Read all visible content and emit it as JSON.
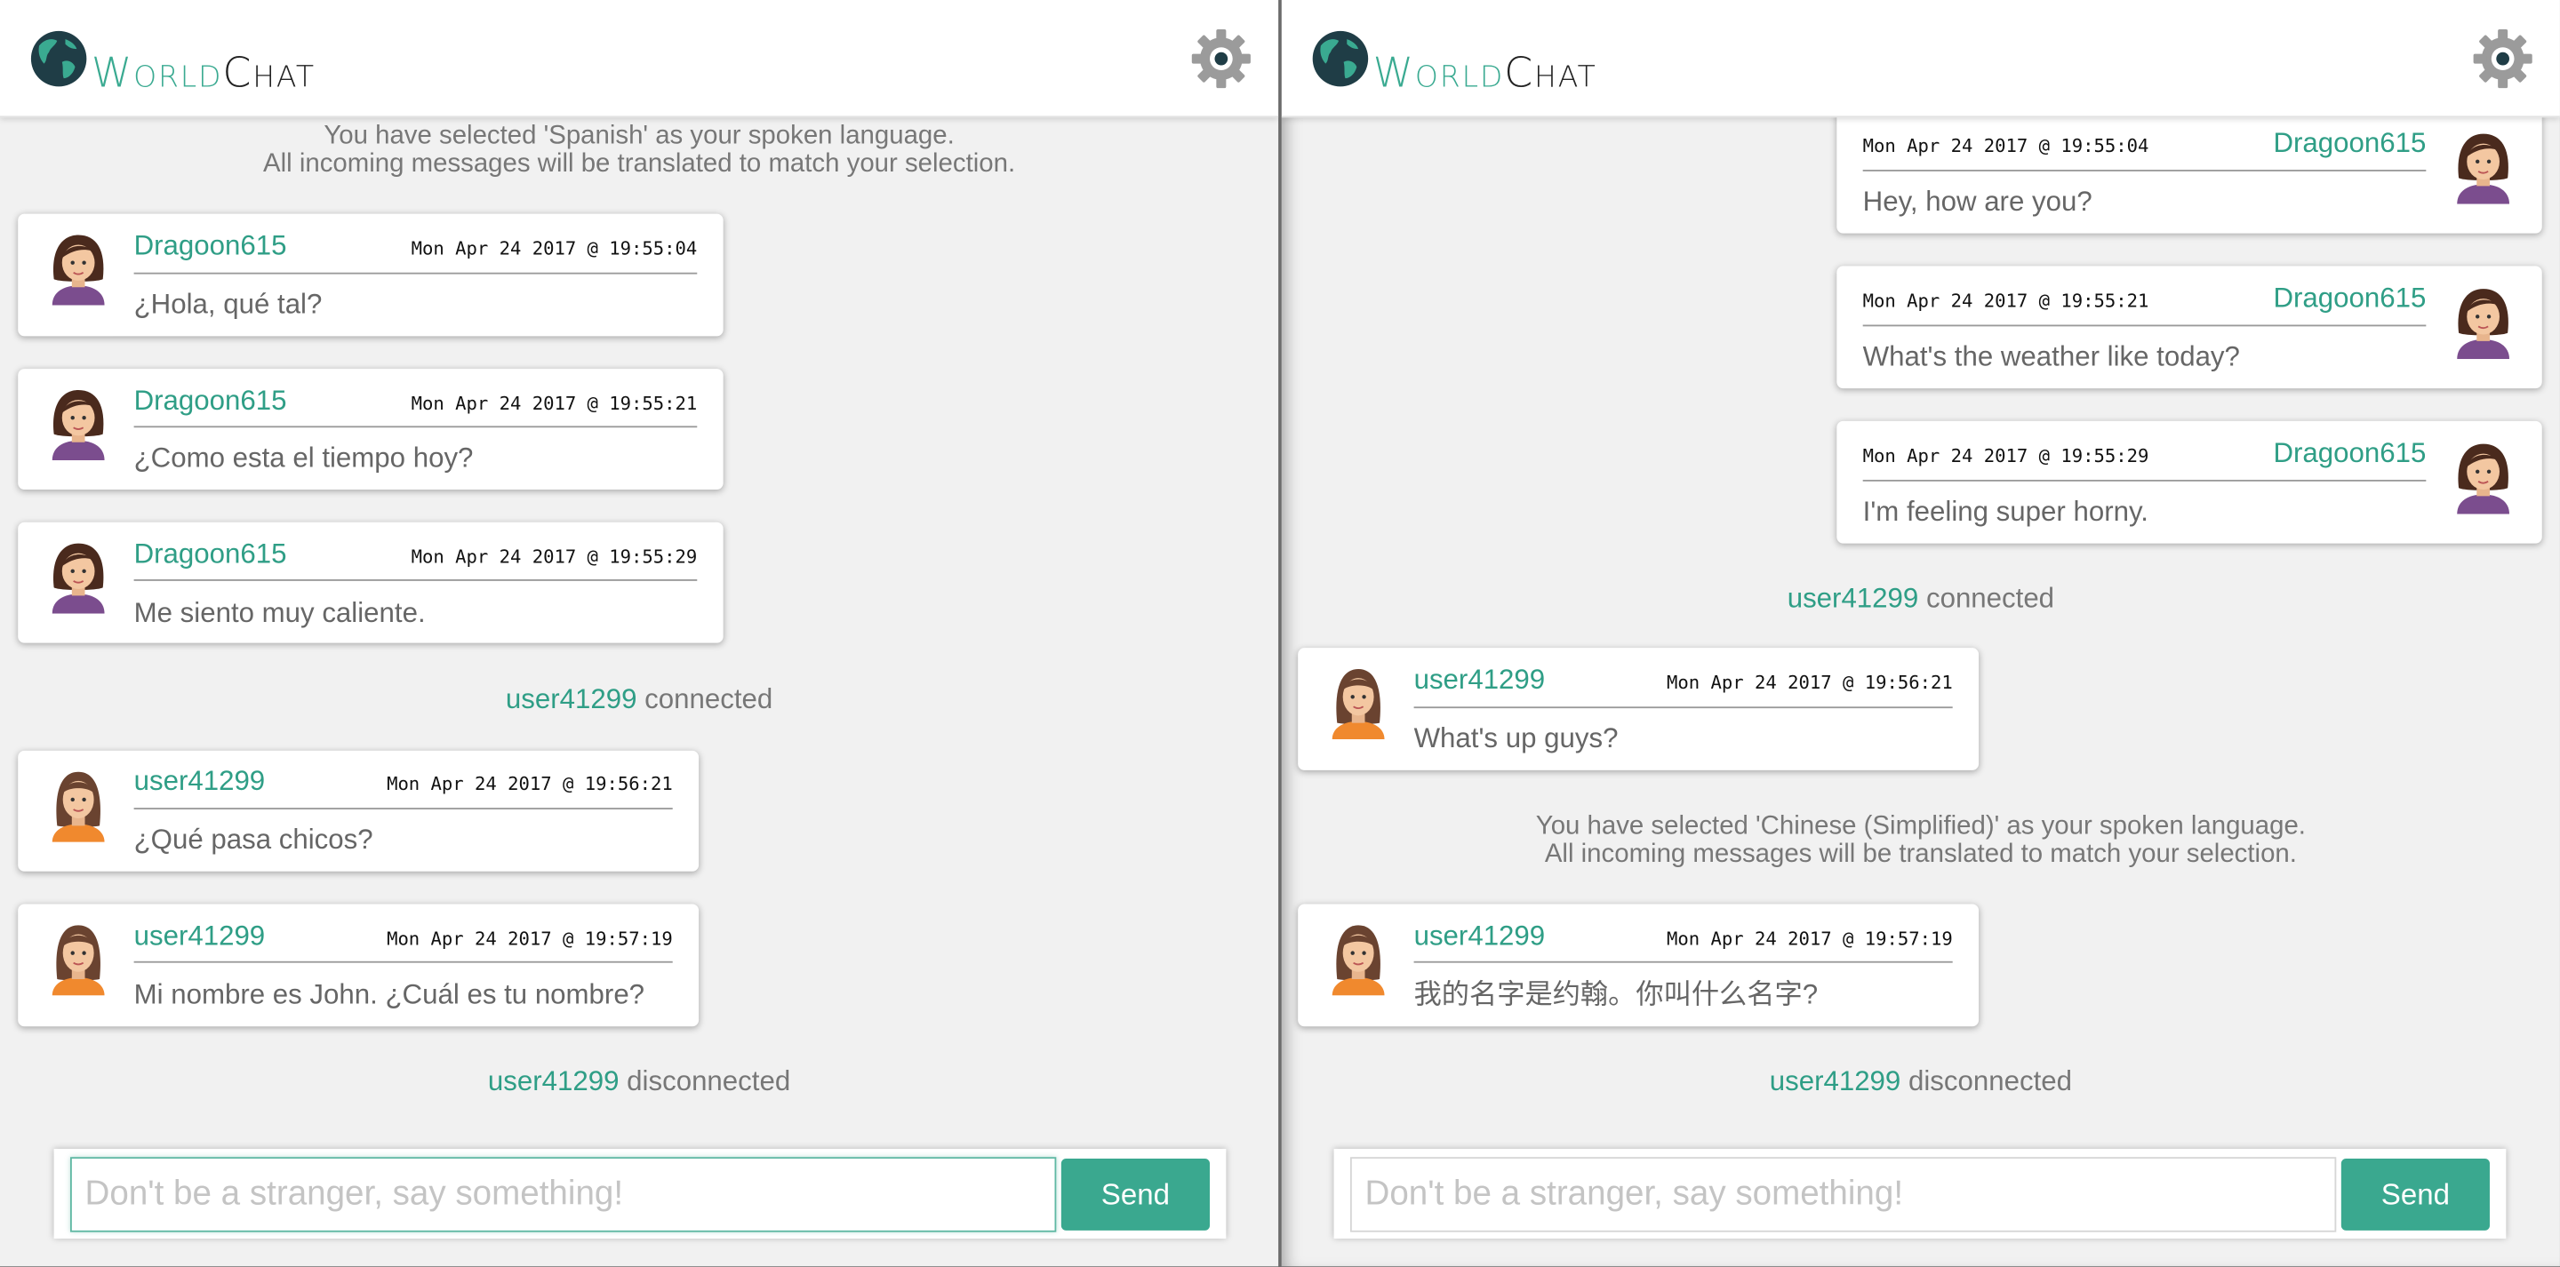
{
  "app": {
    "logo_part1": "World",
    "logo_part2": "Chat"
  },
  "colors": {
    "accent": "#3aaa91",
    "background": "#f1f1f1"
  },
  "left": {
    "language_notice": {
      "line1": "You have selected 'Spanish' as your spoken language.",
      "line2": "All incoming messages will be translated to match your selection."
    },
    "messages": [
      {
        "user": "Dragoon615",
        "time": "Mon Apr 24 2017 @ 19:55:04",
        "text": "¿Hola, qué tal?"
      },
      {
        "user": "Dragoon615",
        "time": "Mon Apr 24 2017 @ 19:55:21",
        "text": "¿Como esta el tiempo hoy?"
      },
      {
        "user": "Dragoon615",
        "time": "Mon Apr 24 2017 @ 19:55:29",
        "text": "Me siento muy caliente."
      },
      {
        "user": "user41299",
        "time": "Mon Apr 24 2017 @ 19:56:21",
        "text": "¿Qué pasa chicos?"
      },
      {
        "user": "user41299",
        "time": "Mon Apr 24 2017 @ 19:57:19",
        "text": "Mi nombre es John. ¿Cuál es tu nombre?"
      }
    ],
    "status_connected": {
      "user": "user41299",
      "text": "connected"
    },
    "status_disconnected": {
      "user": "user41299",
      "text": "disconnected"
    },
    "composer": {
      "placeholder": "Don't be a stranger, say something!",
      "send_label": "Send"
    }
  },
  "right": {
    "messages_own": [
      {
        "user": "Dragoon615",
        "time": "Mon Apr 24 2017 @ 19:55:04",
        "text": "Hey, how are you?"
      },
      {
        "user": "Dragoon615",
        "time": "Mon Apr 24 2017 @ 19:55:21",
        "text": "What's the weather like today?"
      },
      {
        "user": "Dragoon615",
        "time": "Mon Apr 24 2017 @ 19:55:29",
        "text": "I'm feeling super horny."
      }
    ],
    "status_connected": {
      "user": "user41299",
      "text": "connected"
    },
    "messages": [
      {
        "user": "user41299",
        "time": "Mon Apr 24 2017 @ 19:56:21",
        "text": "What's up guys?"
      },
      {
        "user": "user41299",
        "time": "Mon Apr 24 2017 @ 19:57:19",
        "text": "我的名字是约翰。你叫什么名字?"
      }
    ],
    "language_notice": {
      "line1": "You have selected 'Chinese (Simplified)' as your spoken language.",
      "line2": "All incoming messages will be translated to match your selection."
    },
    "status_disconnected": {
      "user": "user41299",
      "text": "disconnected"
    },
    "composer": {
      "placeholder": "Don't be a stranger, say something!",
      "send_label": "Send"
    }
  },
  "icons": {
    "logo": "globe-icon",
    "settings": "gear-icon",
    "avatar_a": "avatar-icon",
    "avatar_b": "avatar-icon"
  }
}
